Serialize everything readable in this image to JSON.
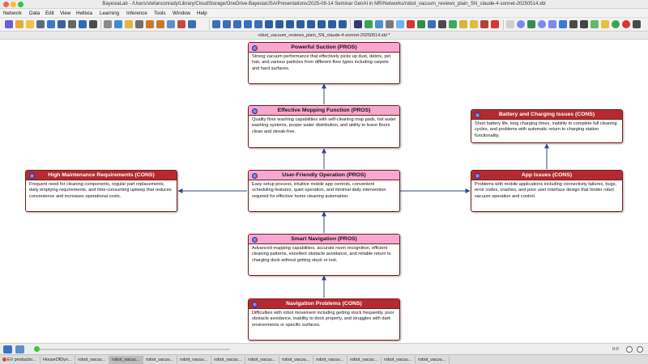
{
  "window": {
    "title": "BayesiaLab - /Users/stefanconrady/Library/CloudStorage/OneDrive-BayesiaUSA/Presentations/2025-08-14 Seminar GenAI in MR/Networks/robot_vacuum_reviews_plain_SN_claude-4-sonnet-20250514.xbl"
  },
  "menu": [
    "Network",
    "Data",
    "Edit",
    "View",
    "Hellixia",
    "Learning",
    "Inference",
    "Tools",
    "Window",
    "Help"
  ],
  "document_tab": "robot_vacuum_reviews_plain_SN_claude-4-sonnet-20250514.xbl *",
  "nodes": {
    "powerful_suction": {
      "title": "Powerful Suction (PROS)",
      "text": "Strong vacuum performance that effectively picks up dust, debris, pet hair, and various particles from different floor types including carpets and hard surfaces."
    },
    "mopping": {
      "title": "Effective Mopping Function (PROS)",
      "text": "Quality floor washing capabilities with self-cleaning mop pads, hot water washing systems, proper water distribution, and ability to leave floors clean and streak-free."
    },
    "battery": {
      "title": "Battery and Charging Issues (CONS)",
      "text": "Short battery life, long charging times, inability to complete full cleaning cycles, and problems with automatic return to charging station functionality."
    },
    "maintenance": {
      "title": "High Maintenance Requirements (CONS)",
      "text": "Frequent need for cleaning components, regular part replacements, daily emptying requirements, and time-consuming upkeep that reduces convenience and increases operational costs."
    },
    "user_friendly": {
      "title": "User-Friendly Operation (PROS)",
      "text": "Easy setup process, intuitive mobile app controls, convenient scheduling features, quiet operation, and minimal daily intervention required for effective home cleaning automation."
    },
    "app_issues": {
      "title": "App Issues (CONS)",
      "text": "Problems with mobile applications including connectivity failures, bugs, error codes, crashes, and poor user interface design that hinder robot vacuum operation and control."
    },
    "smart_navigation": {
      "title": "Smart Navigation (PROS)",
      "text": "Advanced mapping capabilities, accurate room recognition, efficient cleaning patterns, excellent obstacle avoidance, and reliable return to charging dock without getting stuck or lost."
    },
    "navigation_problems": {
      "title": "Navigation Problems (CONS)",
      "text": "Difficulties with robot movement including getting stuck frequently, poor obstacle avoidance, inability to dock properly, and struggles with dark environments or specific surfaces."
    }
  },
  "status": {
    "zoom": "0:0"
  },
  "taskbar": [
    "EV productio...",
    "HouseOfDyn...",
    "robot_vacuu...",
    "robot_vacuu...",
    "robot_vacuu...",
    "robot_vacuu...",
    "robot_vacuu...",
    "robot_vacuu...",
    "robot_vacuu...",
    "robot_vacuu...",
    "robot_vacuu...",
    "robot_vacuu...",
    "robot_vacuu..."
  ],
  "colors": {
    "pros_header": "#f7a8d0",
    "cons_header": "#b42a30",
    "edge": "#2d4a78"
  }
}
